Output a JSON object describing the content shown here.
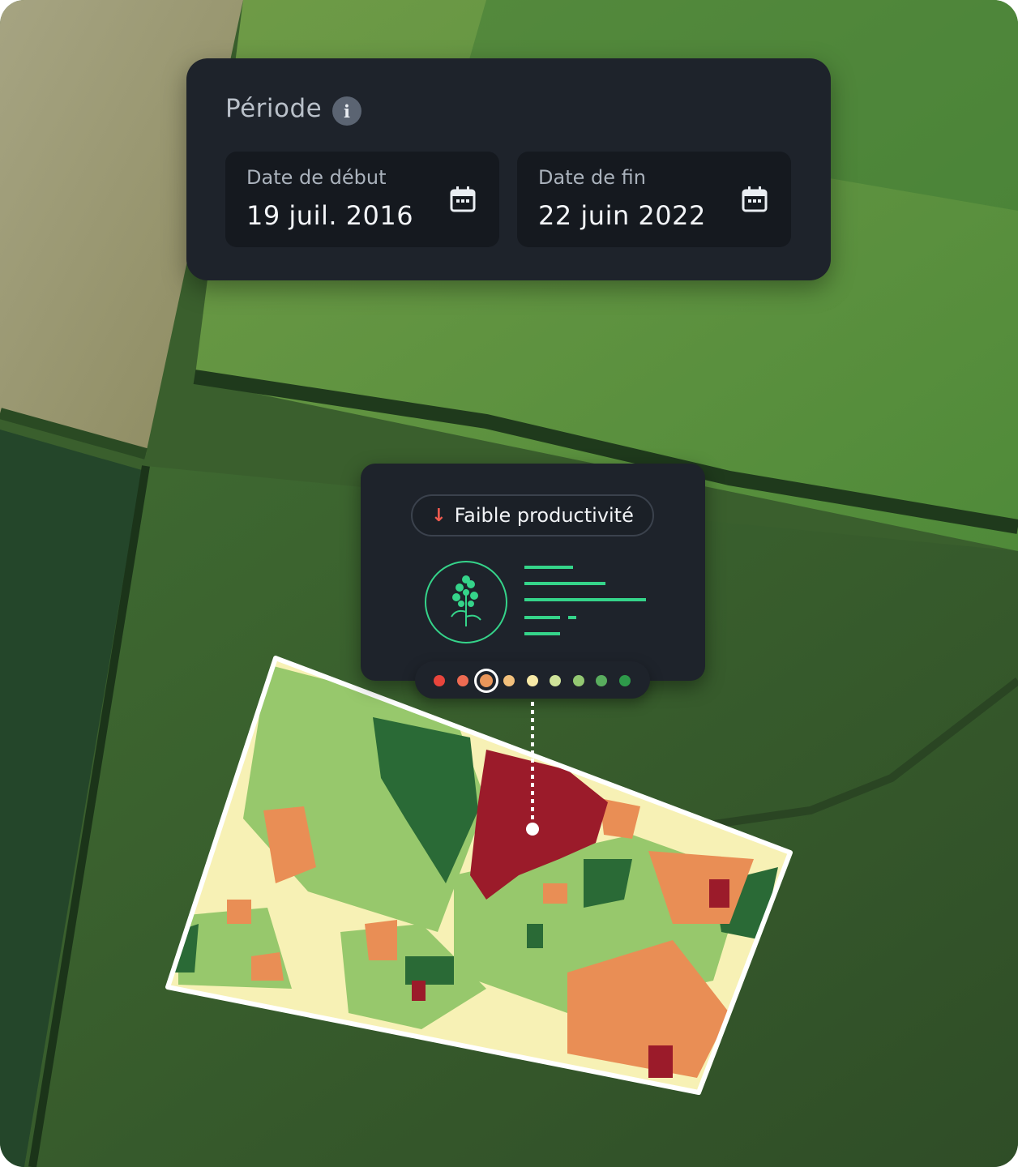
{
  "periode": {
    "title": "Période",
    "info_icon": "info-icon",
    "start": {
      "label": "Date de début",
      "value": "19 juil. 2016",
      "icon": "calendar-icon"
    },
    "end": {
      "label": "Date de fin",
      "value": "22 juin 2022",
      "icon": "calendar-icon"
    }
  },
  "productivity": {
    "badge_label": "Faible productivité",
    "badge_icon": "arrow-down-icon",
    "plant_icon": "plant-icon",
    "scale_colors": [
      "#e8453c",
      "#ee6b52",
      "#e9965a",
      "#f2c07c",
      "#f7e9a6",
      "#cfe39a",
      "#93c872",
      "#59ad5e",
      "#2e9a4a"
    ],
    "selected_index": 2
  },
  "colors": {
    "panel": "#1e232b",
    "accent_green": "#35d48a",
    "low_red": "#9b1b2a"
  }
}
